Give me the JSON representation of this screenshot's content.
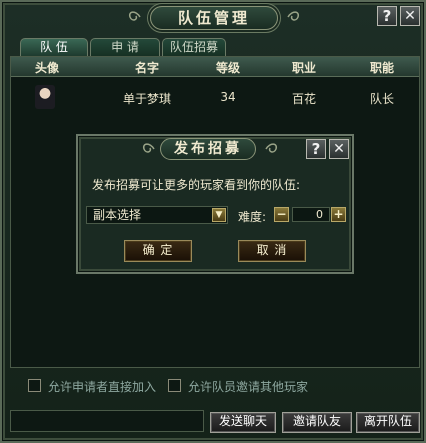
{
  "window": {
    "title": "队伍管理"
  },
  "controls": {
    "help_glyph": "?",
    "close_glyph": "✕"
  },
  "tabs": [
    {
      "label": "队  伍"
    },
    {
      "label": "申  请"
    },
    {
      "label": "队伍招募"
    }
  ],
  "table": {
    "headers": [
      "头像",
      "名字",
      "等级",
      "职业",
      "职能"
    ],
    "rows": [
      {
        "name": "单于梦琪",
        "level": "34",
        "class": "百花",
        "role": "队长"
      }
    ]
  },
  "recruit_dialog": {
    "title": "发布招募",
    "description": "发布招募可让更多的玩家看到你的队伍:",
    "instance_select": "副本选择",
    "difficulty_label": "难度:",
    "difficulty_value": "0",
    "minus_glyph": "−",
    "plus_glyph": "+",
    "confirm_label": "确  定",
    "cancel_label": "取  消"
  },
  "options": {
    "allow_direct_join": "允许申请者直接加入",
    "allow_member_invite": "允许队员邀请其他玩家"
  },
  "bottom_buttons": {
    "send_chat": "发送聊天",
    "invite": "邀请队友",
    "leave": "离开队伍"
  },
  "colors": {
    "panel": "#142219",
    "border": "#5a6a58",
    "text": "#e8e2c8"
  }
}
